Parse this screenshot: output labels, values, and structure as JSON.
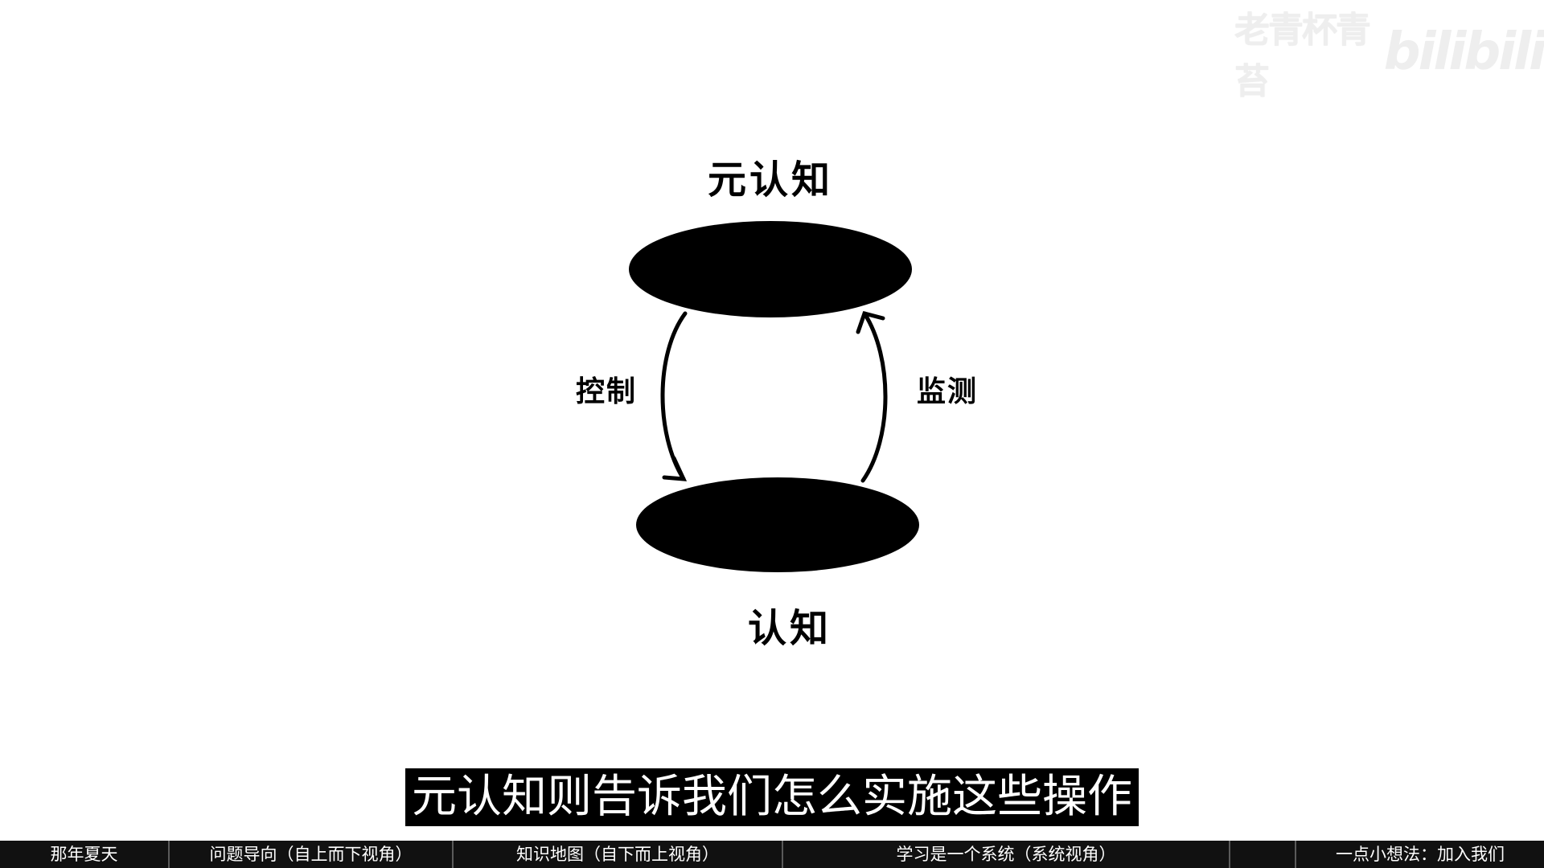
{
  "watermark": {
    "author": "老青杯青苔",
    "logo": "bilibili"
  },
  "diagram": {
    "top_label": "元认知",
    "bottom_label": "认知",
    "left_arrow_label": "控制",
    "right_arrow_label": "监测"
  },
  "subtitle": "元认知则告诉我们怎么实施这些操作",
  "chapters": [
    {
      "label": "那年夏天"
    },
    {
      "label": "问题导向（自上而下视角）"
    },
    {
      "label": "知识地图（自下而上视角）"
    },
    {
      "label": "学习是一个系统（系统视角）"
    },
    {
      "label": ""
    },
    {
      "label": "一点小想法：加入我们"
    }
  ]
}
